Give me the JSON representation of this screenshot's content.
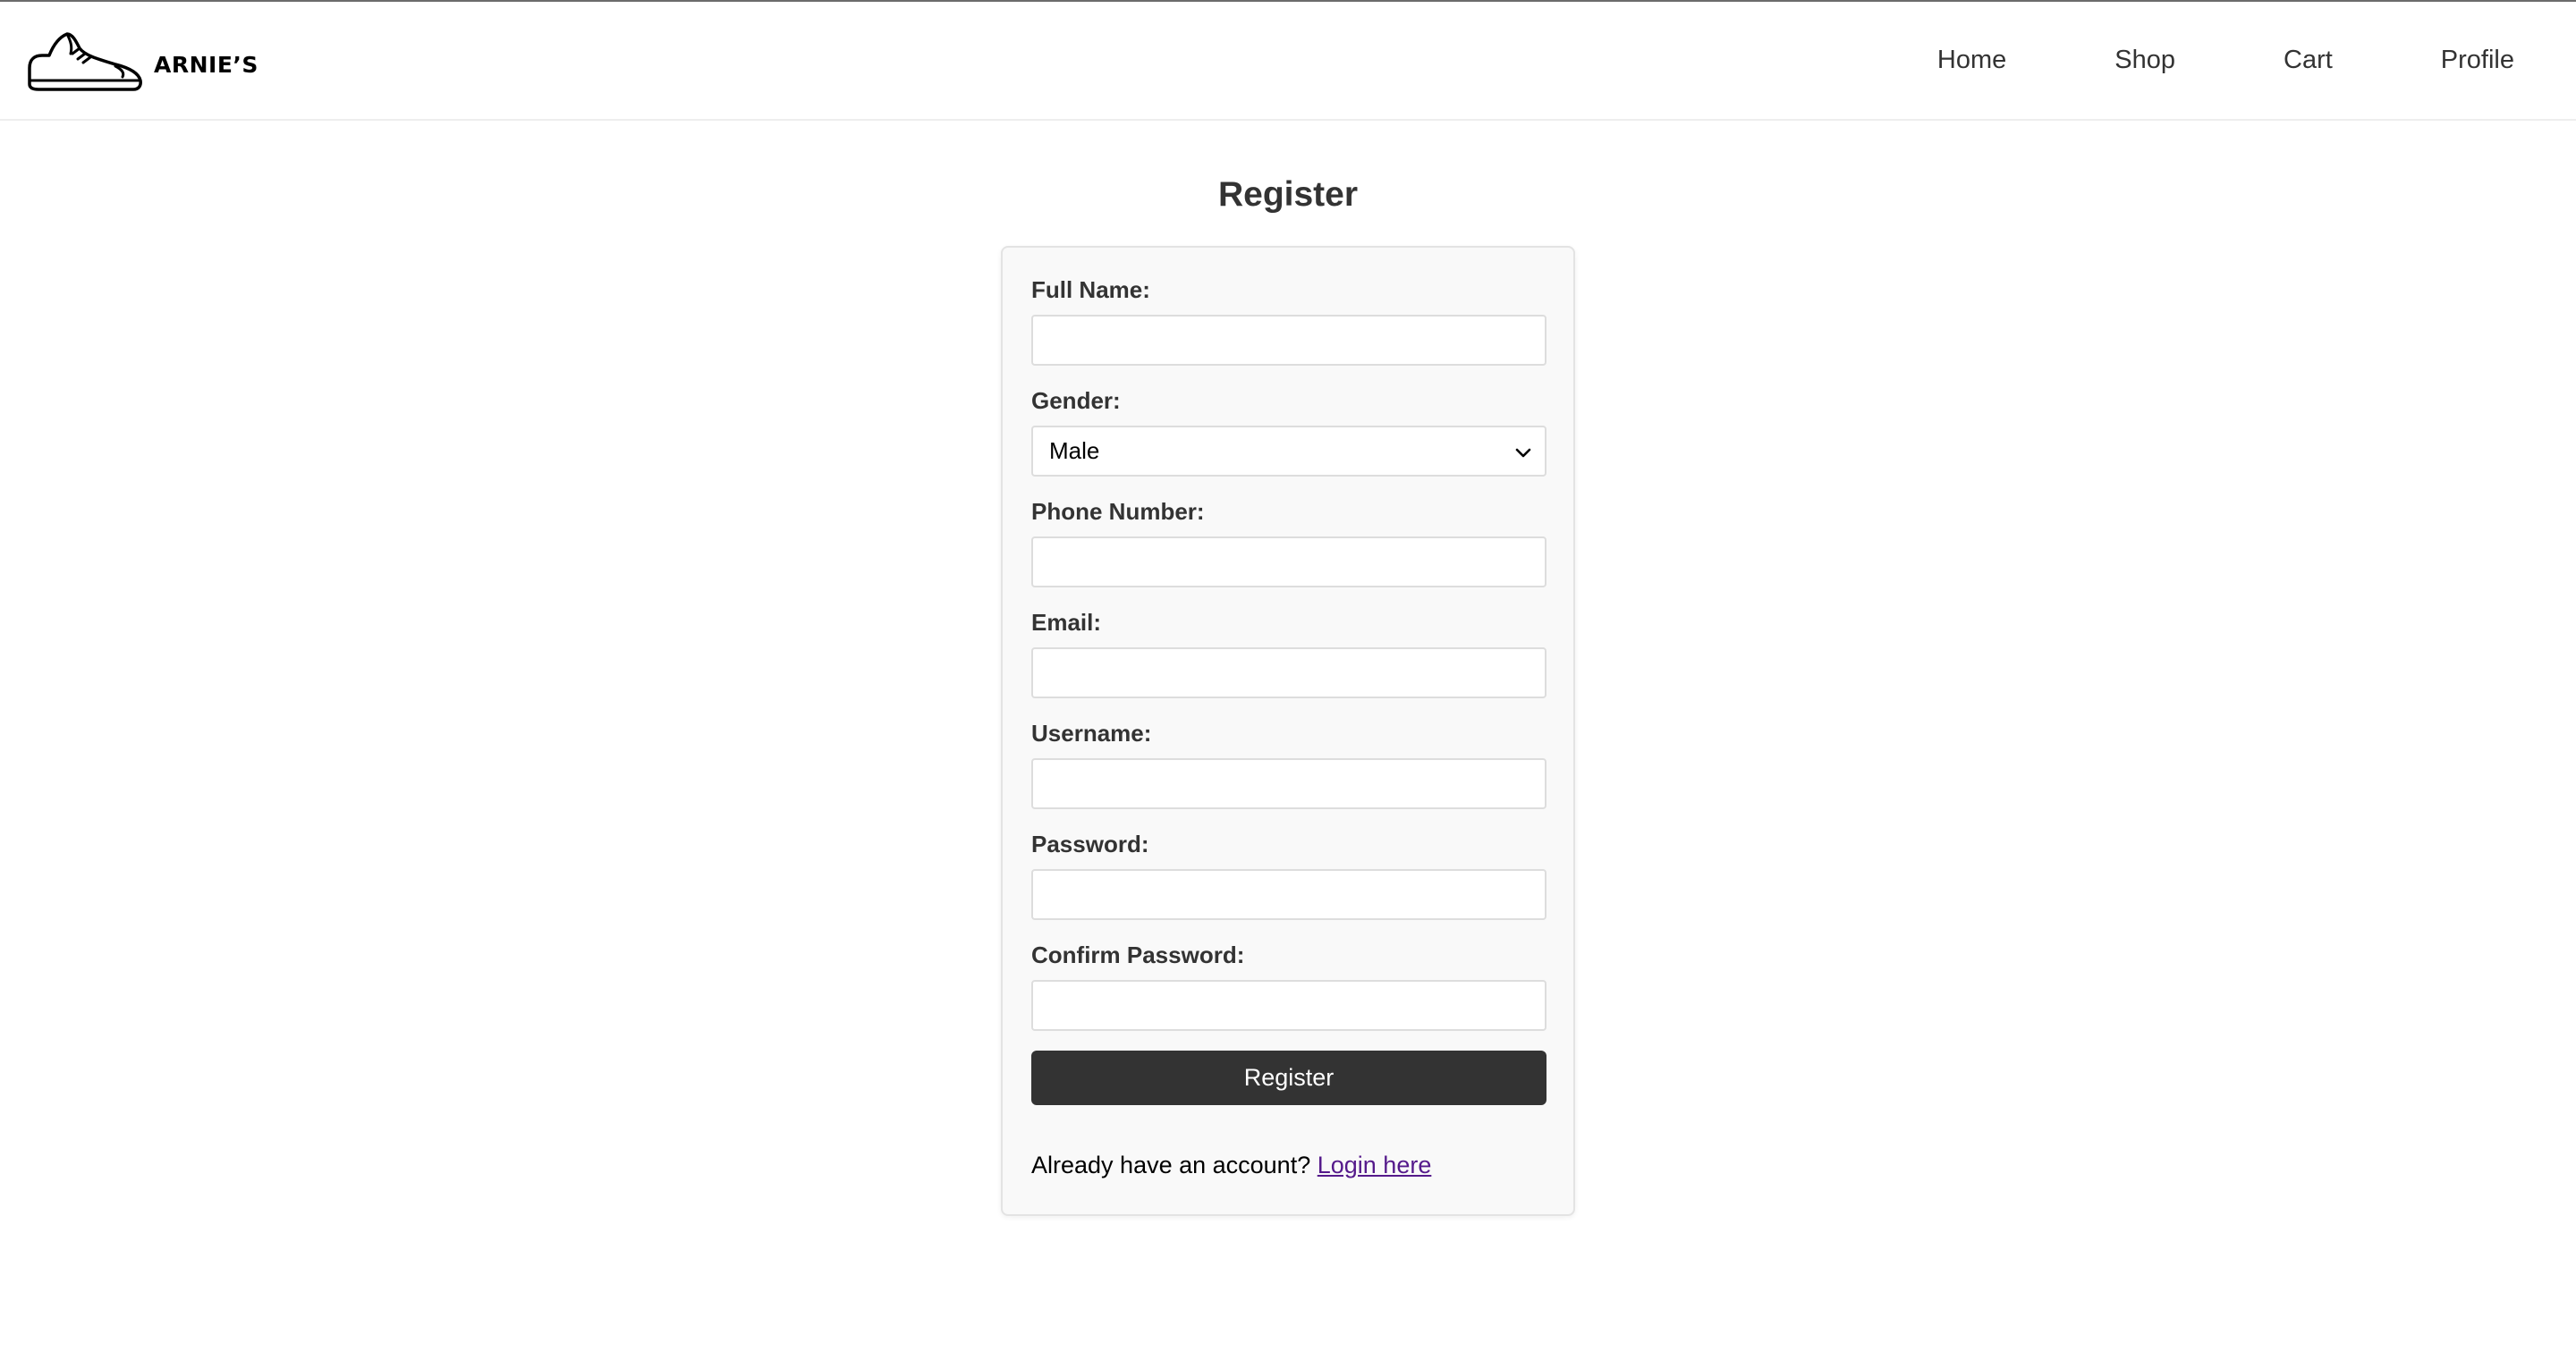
{
  "brand": {
    "name": "ARNIE’S",
    "icon": "sneaker-icon"
  },
  "nav": {
    "home": "Home",
    "shop": "Shop",
    "cart": "Cart",
    "profile": "Profile"
  },
  "page_title": "Register",
  "form": {
    "full_name": {
      "label": "Full Name:",
      "value": ""
    },
    "gender": {
      "label": "Gender:",
      "value": "Male"
    },
    "phone": {
      "label": "Phone Number:",
      "value": ""
    },
    "email": {
      "label": "Email:",
      "value": ""
    },
    "username": {
      "label": "Username:",
      "value": ""
    },
    "password": {
      "label": "Password:",
      "value": ""
    },
    "confirm_password": {
      "label": "Confirm Password:",
      "value": ""
    },
    "submit_label": "Register"
  },
  "login_prompt": {
    "text": "Already have an account?",
    "link": "Login here"
  },
  "colors": {
    "button_bg": "#333333",
    "link": "#551a8b",
    "card_bg": "#f9f9f9"
  }
}
